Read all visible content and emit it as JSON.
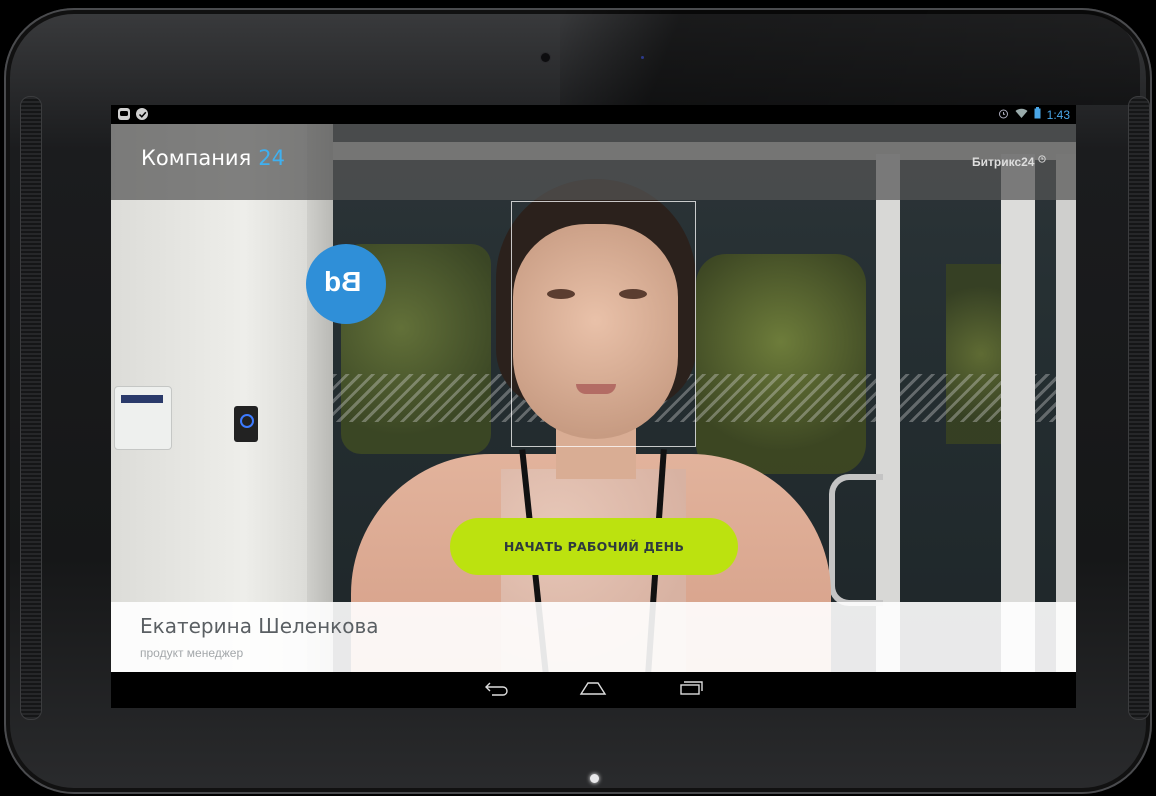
{
  "status_bar": {
    "left_icons": [
      "chat-icon",
      "check-icon"
    ],
    "right_icons": [
      "alarm-icon",
      "wifi-icon",
      "battery-icon"
    ],
    "time": "1:43"
  },
  "header": {
    "company_name": "Компания",
    "company_number": "24",
    "brand": "Битрикс24",
    "brand_mark": "clock-icon"
  },
  "camera_view": {
    "background_sign_text": "Bd",
    "face_detection": true
  },
  "actions": {
    "start_day_label": "НАЧАТЬ РАБОЧИЙ ДЕНЬ"
  },
  "employee": {
    "name": "Екатерина Шеленкова",
    "role": "продукт менеджер"
  },
  "nav_bar": {
    "buttons": [
      "back-icon",
      "home-icon",
      "recent-apps-icon"
    ]
  },
  "colors": {
    "accent": "#bce20f",
    "brand_blue": "#3fb0f0",
    "status_time": "#4aa7e8"
  }
}
